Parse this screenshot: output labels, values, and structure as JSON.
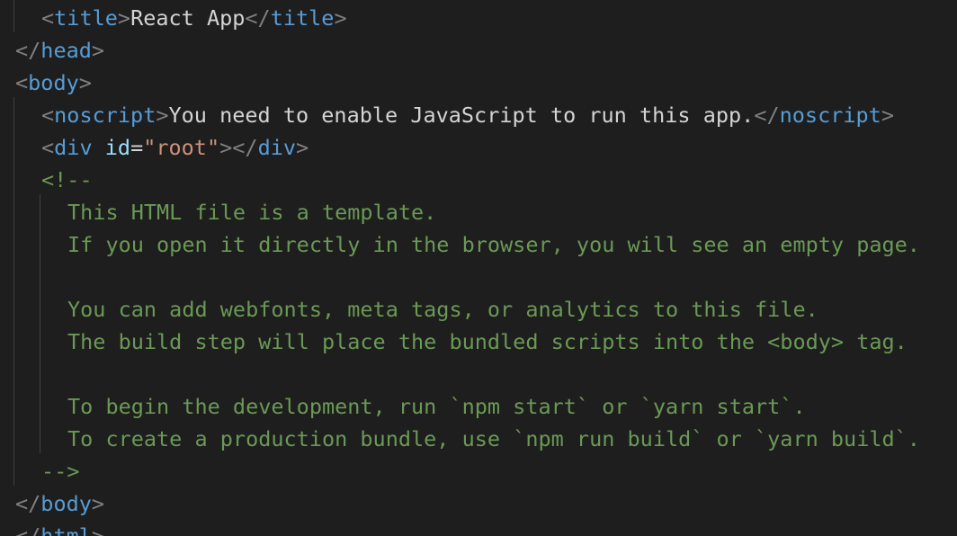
{
  "editor": {
    "colors": {
      "background": "#1e1e1e",
      "bracket": "#808080",
      "tag": "#569cd6",
      "attribute": "#9cdcfe",
      "string": "#ce9178",
      "text": "#d4d4d4",
      "comment": "#6a9955",
      "indent_guide": "#404040"
    },
    "lines": [
      {
        "indent": 1,
        "tokens": [
          {
            "k": "bracket",
            "t": "<"
          },
          {
            "k": "tag",
            "t": "title"
          },
          {
            "k": "bracket",
            "t": ">"
          },
          {
            "k": "text",
            "t": "React App"
          },
          {
            "k": "bracket",
            "t": "</"
          },
          {
            "k": "tag",
            "t": "title"
          },
          {
            "k": "bracket",
            "t": ">"
          }
        ]
      },
      {
        "indent": 0,
        "tokens": [
          {
            "k": "bracket",
            "t": "</"
          },
          {
            "k": "tag",
            "t": "head"
          },
          {
            "k": "bracket",
            "t": ">"
          }
        ]
      },
      {
        "indent": 0,
        "tokens": [
          {
            "k": "bracket",
            "t": "<"
          },
          {
            "k": "tag",
            "t": "body"
          },
          {
            "k": "bracket",
            "t": ">"
          }
        ]
      },
      {
        "indent": 1,
        "tokens": [
          {
            "k": "bracket",
            "t": "<"
          },
          {
            "k": "tag",
            "t": "noscript"
          },
          {
            "k": "bracket",
            "t": ">"
          },
          {
            "k": "text",
            "t": "You need to enable JavaScript to run this app."
          },
          {
            "k": "bracket",
            "t": "</"
          },
          {
            "k": "tag",
            "t": "noscript"
          },
          {
            "k": "bracket",
            "t": ">"
          }
        ]
      },
      {
        "indent": 1,
        "tokens": [
          {
            "k": "bracket",
            "t": "<"
          },
          {
            "k": "tag",
            "t": "div"
          },
          {
            "k": "text",
            "t": " "
          },
          {
            "k": "attribute",
            "t": "id"
          },
          {
            "k": "text",
            "t": "="
          },
          {
            "k": "string",
            "t": "\"root\""
          },
          {
            "k": "bracket",
            "t": "></"
          },
          {
            "k": "tag",
            "t": "div"
          },
          {
            "k": "bracket",
            "t": ">"
          }
        ]
      },
      {
        "indent": 1,
        "tokens": [
          {
            "k": "comment",
            "t": "<!--"
          }
        ]
      },
      {
        "indent": 2,
        "tokens": [
          {
            "k": "comment",
            "t": "This HTML file is a template."
          }
        ]
      },
      {
        "indent": 2,
        "tokens": [
          {
            "k": "comment",
            "t": "If you open it directly in the browser, you will see an empty page."
          }
        ]
      },
      {
        "indent": 2,
        "tokens": []
      },
      {
        "indent": 2,
        "tokens": [
          {
            "k": "comment",
            "t": "You can add webfonts, meta tags, or analytics to this file."
          }
        ]
      },
      {
        "indent": 2,
        "tokens": [
          {
            "k": "comment",
            "t": "The build step will place the bundled scripts into the <body> tag."
          }
        ]
      },
      {
        "indent": 2,
        "tokens": []
      },
      {
        "indent": 2,
        "tokens": [
          {
            "k": "comment",
            "t": "To begin the development, run `npm start` or `yarn start`."
          }
        ]
      },
      {
        "indent": 2,
        "tokens": [
          {
            "k": "comment",
            "t": "To create a production bundle, use `npm run build` or `yarn build`."
          }
        ]
      },
      {
        "indent": 1,
        "tokens": [
          {
            "k": "comment",
            "t": "-->"
          }
        ]
      },
      {
        "indent": 0,
        "tokens": [
          {
            "k": "bracket",
            "t": "</"
          },
          {
            "k": "tag",
            "t": "body"
          },
          {
            "k": "bracket",
            "t": ">"
          }
        ]
      },
      {
        "indent": 0,
        "tokens": [
          {
            "k": "bracket",
            "t": "</"
          },
          {
            "k": "tag",
            "t": "html"
          },
          {
            "k": "bracket",
            "t": ">"
          }
        ]
      }
    ]
  }
}
